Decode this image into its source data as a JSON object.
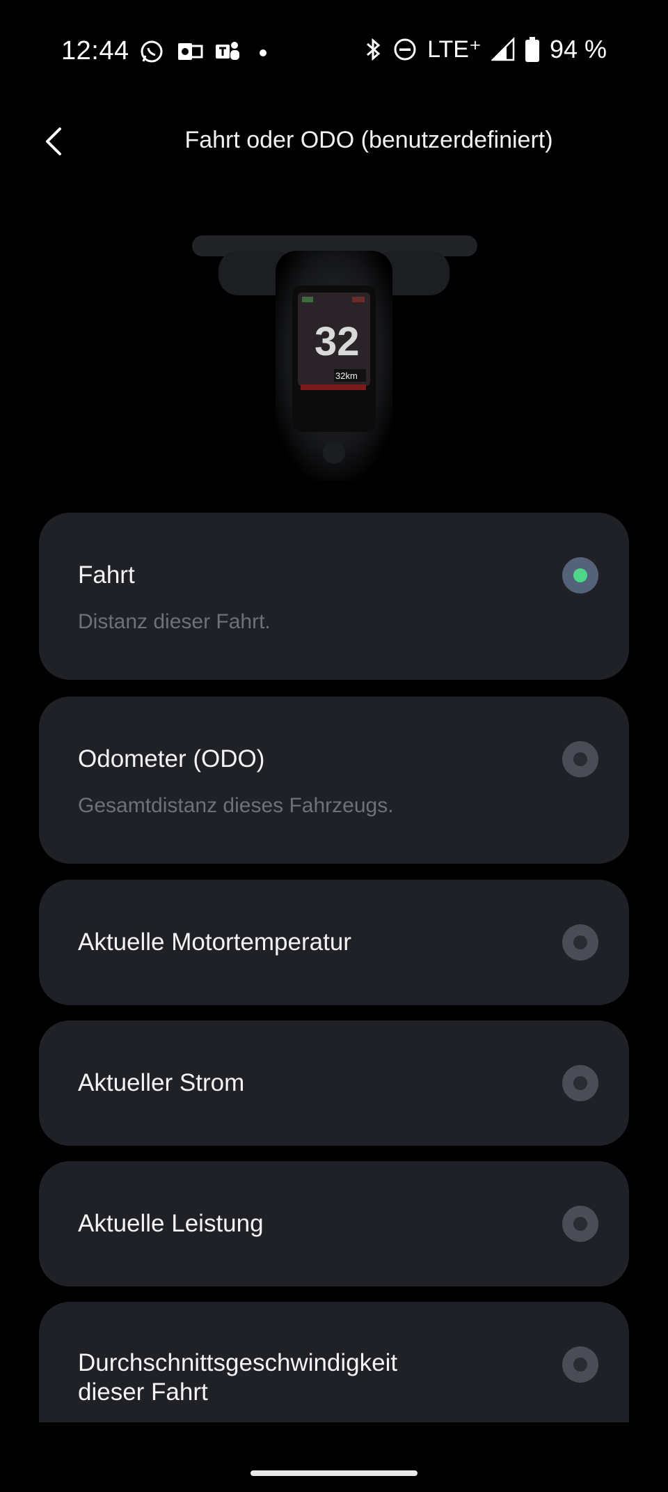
{
  "status_bar": {
    "time": "12:44",
    "network": "LTE⁺",
    "battery": "94 %",
    "left_icons": [
      "whatsapp-icon",
      "outlook-icon",
      "teams-icon",
      "notification-dot-icon"
    ],
    "right_icons": [
      "bluetooth-icon",
      "do-not-disturb-icon",
      "signal-icon",
      "battery-icon"
    ]
  },
  "header": {
    "title": "Fahrt oder ODO (benutzerdefiniert)"
  },
  "hero": {
    "display_speed": "32",
    "display_distance": "32km"
  },
  "options": [
    {
      "title": "Fahrt",
      "subtitle": "Distanz dieser Fahrt.",
      "selected": true
    },
    {
      "title": "Odometer (ODO)",
      "subtitle": "Gesamtdistanz dieses Fahrzeugs.",
      "selected": false
    },
    {
      "title": "Aktuelle Motortemperatur",
      "selected": false
    },
    {
      "title": "Aktueller Strom",
      "selected": false
    },
    {
      "title": "Aktuelle Leistung",
      "selected": false
    },
    {
      "title_line1": "Durchschnittsgeschwindigkeit",
      "title_line2": "dieser Fahrt",
      "selected": false
    }
  ],
  "colors": {
    "background": "#000000",
    "card": "#1f2126",
    "accent": "#4ed68a"
  }
}
